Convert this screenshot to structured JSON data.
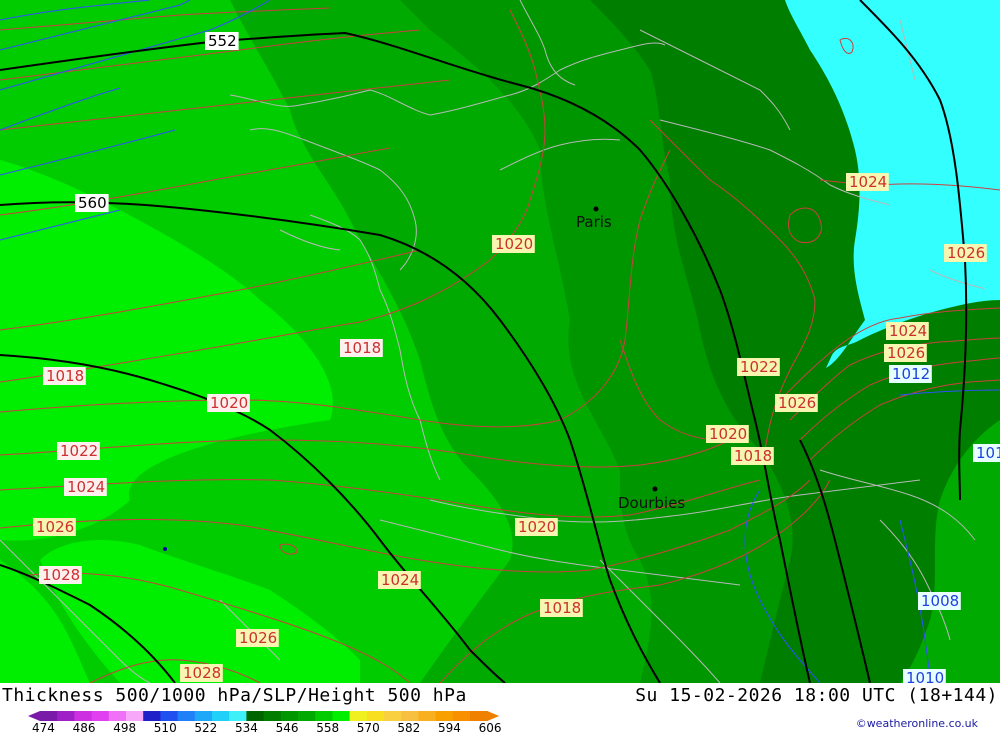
{
  "map": {
    "city_labels": [
      "Paris",
      "Dourbies"
    ],
    "thickness_labels": [
      "552",
      "560"
    ],
    "pressure_labels": [
      "1024",
      "1026",
      "1020",
      "1018",
      "1018",
      "1020",
      "1022",
      "1024",
      "1026",
      "1028",
      "1028",
      "1026",
      "1024",
      "1020",
      "1018",
      "1022",
      "1026",
      "1020",
      "1018",
      "1024",
      "1026",
      "1012",
      "1008",
      "1010",
      "101"
    ],
    "colors": {
      "zone_light": "#00ee00",
      "zone_mid": "#00cc00",
      "zone_dark": "#00aa00",
      "zone_darker": "#009600",
      "zone_darkest": "#007e00",
      "sea_cyan": "#33ffff",
      "thickness_line": "#000000",
      "pressure_line": "#cc4040",
      "low_pressure_line": "#3050ff",
      "coast_line": "#b8b8b8"
    }
  },
  "footer": {
    "title": "Thickness 500/1000 hPa/SLP/Height 500 hPa",
    "datetime": "Su 15-02-2026 18:00 UTC (18+144)",
    "credit": "©weatheronline.co.uk",
    "legend_ticks": [
      "474",
      "486",
      "498",
      "510",
      "522",
      "534",
      "546",
      "558",
      "570",
      "582",
      "594",
      "606"
    ],
    "legend_colors": [
      "#7a1aa8",
      "#a020c8",
      "#cc30e0",
      "#e040f0",
      "#f070f8",
      "#f8a8f8",
      "#2020c8",
      "#2050f0",
      "#2080f8",
      "#20a8f8",
      "#20d0f8",
      "#40f0f8",
      "#006400",
      "#007e00",
      "#009600",
      "#00aa00",
      "#00cc00",
      "#00ee00",
      "#f0f020",
      "#f8e020",
      "#f8d040",
      "#f8c040",
      "#f8b020",
      "#f8a000",
      "#f89000",
      "#f08000"
    ]
  }
}
